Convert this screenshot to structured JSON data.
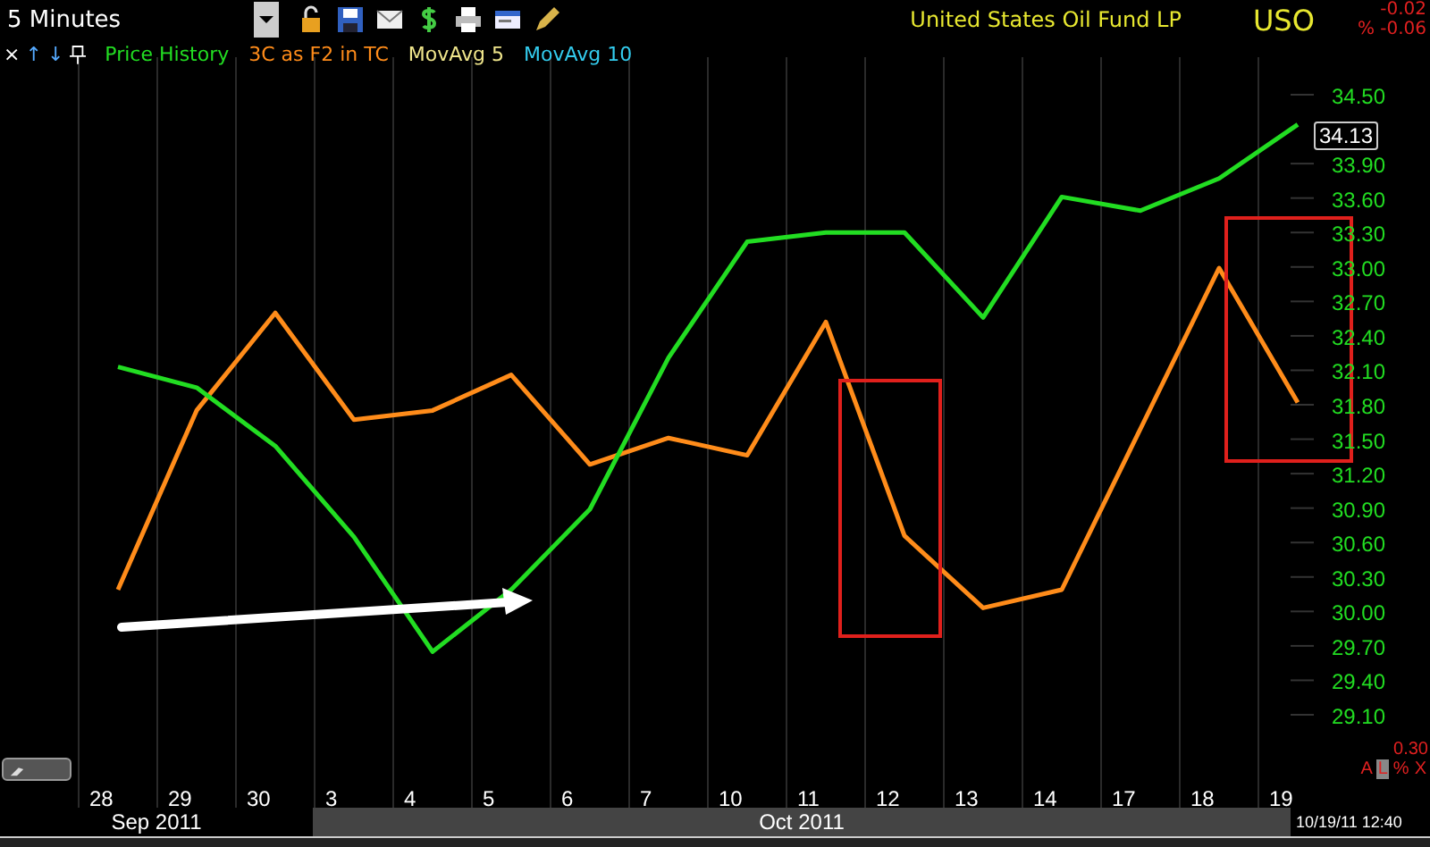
{
  "toolbar": {
    "interval": "5 Minutes",
    "title": "United States Oil Fund LP",
    "symbol": "USO",
    "change": "-0.02",
    "change_pct": "% -0.06"
  },
  "legend_controls": [
    "×",
    "↑",
    "↓"
  ],
  "legend": [
    {
      "label": "MovAvg 5",
      "color": "#f0e68c"
    },
    {
      "label": "MovAvg 10",
      "color": "#33ccee"
    }
  ],
  "chart": {
    "chart_data": {
      "type": "line",
      "categories": [
        "28",
        "29",
        "30",
        "3",
        "4",
        "5",
        "6",
        "7",
        "10",
        "11",
        "12",
        "13",
        "14",
        "17",
        "18",
        "19"
      ],
      "series": [
        {
          "name": "Price History",
          "color": "#22dd22",
          "values": [
            32.13,
            31.95,
            31.44,
            30.65,
            29.65,
            30.19,
            30.89,
            32.21,
            33.22,
            33.3,
            33.3,
            32.56,
            33.61,
            33.49,
            33.77,
            34.24
          ]
        },
        {
          "name": "3C as F2 in TC",
          "color": "#ff8c1a",
          "values": [
            30.19,
            31.75,
            32.6,
            31.67,
            31.75,
            32.06,
            31.28,
            31.51,
            31.36,
            32.52,
            30.66,
            30.03,
            30.19,
            31.59,
            32.99,
            31.82
          ]
        }
      ],
      "ylim": [
        29.1,
        34.5
      ],
      "yticks": [
        {
          "value": 34.5,
          "label": "34.50"
        },
        {
          "value": 33.9,
          "label": "33.90"
        },
        {
          "value": 33.6,
          "label": "33.60"
        },
        {
          "value": 33.3,
          "label": "33.30"
        },
        {
          "value": 33.0,
          "label": "33.00"
        },
        {
          "value": 32.7,
          "label": "32.70"
        },
        {
          "value": 32.4,
          "label": "32.40"
        },
        {
          "value": 32.1,
          "label": "32.10"
        },
        {
          "value": 31.8,
          "label": "31.80"
        },
        {
          "value": 31.5,
          "label": "31.50"
        },
        {
          "value": 31.2,
          "label": "31.20"
        },
        {
          "value": 30.9,
          "label": "30.90"
        },
        {
          "value": 30.6,
          "label": "30.60"
        },
        {
          "value": 30.3,
          "label": "30.30"
        },
        {
          "value": 30.0,
          "label": "30.00"
        },
        {
          "value": 29.7,
          "label": "29.70"
        },
        {
          "value": 29.4,
          "label": "29.40"
        },
        {
          "value": 29.1,
          "label": "29.10"
        }
      ]
    },
    "last_price": "34.13",
    "scale": "0.30",
    "scale_buttons": [
      {
        "label": "A",
        "selected": false
      },
      {
        "label": "L",
        "selected": true
      },
      {
        "label": "%",
        "selected": false
      },
      {
        "label": "X",
        "selected": false
      }
    ],
    "timestamp": "10/19/11 12:40"
  },
  "months": [
    {
      "label": "Sep 2011",
      "shaded": false
    },
    {
      "label": "Oct 2011",
      "shaded": true
    }
  ]
}
